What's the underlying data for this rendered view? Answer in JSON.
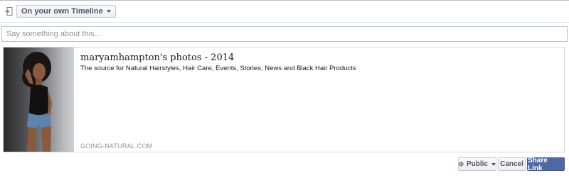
{
  "header": {
    "audience_label": "On your own Timeline"
  },
  "composer": {
    "placeholder": "Say something about this...",
    "value": ""
  },
  "link_preview": {
    "title": "maryamhampton's photos - 2014",
    "description": "The source for Natural Hairstyles, Hair Care, Events, Stories, News and Black Hair Products",
    "domain": "GOING-NATURAL.COM"
  },
  "footer": {
    "privacy_label": "Public",
    "cancel_label": "Cancel",
    "share_label": "Share Link"
  },
  "colors": {
    "primary_button": "#4e69a2",
    "border": "#d3d6db"
  },
  "icons": {
    "share_target": "share-to-timeline-icon",
    "privacy": "globe-icon",
    "dropdown": "chevron-down-icon"
  }
}
